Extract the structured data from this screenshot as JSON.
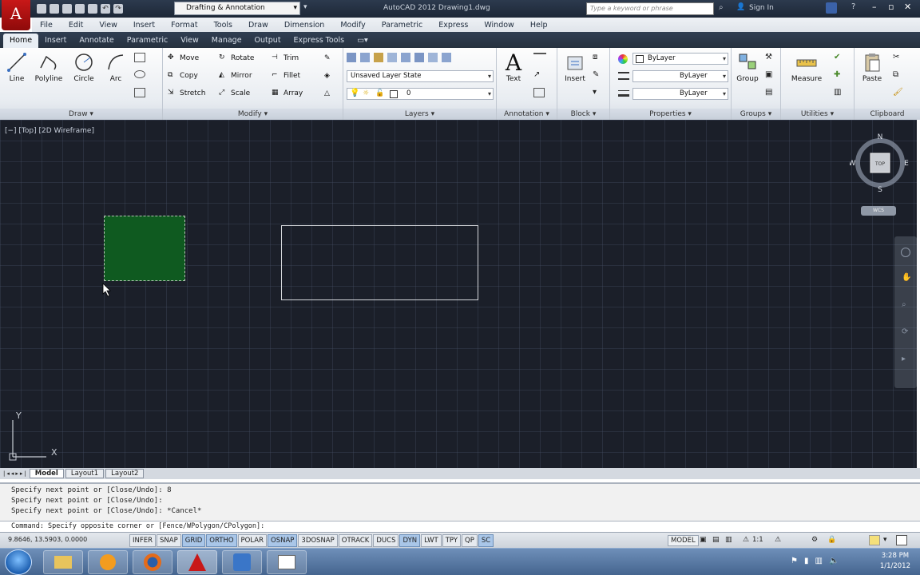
{
  "titlebar": {
    "workspace": "Drafting & Annotation",
    "title": "AutoCAD 2012   Drawing1.dwg",
    "search_placeholder": "Type a keyword or phrase",
    "signin": "Sign In"
  },
  "menubar": [
    "File",
    "Edit",
    "View",
    "Insert",
    "Format",
    "Tools",
    "Draw",
    "Dimension",
    "Modify",
    "Parametric",
    "Express",
    "Window",
    "Help"
  ],
  "tabs": [
    "Home",
    "Insert",
    "Annotate",
    "Parametric",
    "View",
    "Manage",
    "Output",
    "Express Tools"
  ],
  "ribbon": {
    "draw": {
      "title": "Draw",
      "line": "Line",
      "polyline": "Polyline",
      "circle": "Circle",
      "arc": "Arc"
    },
    "modify": {
      "title": "Modify",
      "move": "Move",
      "rotate": "Rotate",
      "trim": "Trim",
      "copy": "Copy",
      "mirror": "Mirror",
      "fillet": "Fillet",
      "stretch": "Stretch",
      "scale": "Scale",
      "array": "Array"
    },
    "layers": {
      "title": "Layers",
      "state": "Unsaved Layer State",
      "current": "0"
    },
    "annotation": {
      "title": "Annotation",
      "text": "Text"
    },
    "block": {
      "title": "Block",
      "insert": "Insert"
    },
    "properties": {
      "title": "Properties",
      "color": "ByLayer",
      "linetype": "ByLayer",
      "lineweight": "ByLayer"
    },
    "groups": {
      "title": "Groups",
      "group": "Group"
    },
    "utilities": {
      "title": "Utilities",
      "measure": "Measure"
    },
    "clipboard": {
      "title": "Clipboard",
      "paste": "Paste"
    }
  },
  "viewport": {
    "label": "[−] [Top] [2D Wireframe]",
    "compass": {
      "n": "N",
      "s": "S",
      "e": "E",
      "w": "W",
      "top": "TOP",
      "wcs": "WCS"
    },
    "ucs_y": "Y",
    "ucs_x": "X"
  },
  "layout_tabs": [
    "Model",
    "Layout1",
    "Layout2"
  ],
  "command": {
    "history": [
      "Specify next point or [Close/Undo]: 8",
      "Specify next point or [Close/Undo]:",
      "Specify next point or [Close/Undo]: *Cancel*"
    ],
    "prompt": "Command: Specify opposite corner or [Fence/WPolygon/CPolygon]:"
  },
  "status": {
    "coords": "9.8646, 13.5903, 0.0000",
    "toggles": [
      "INFER",
      "SNAP",
      "GRID",
      "ORTHO",
      "POLAR",
      "OSNAP",
      "3DOSNAP",
      "OTRACK",
      "DUCS",
      "DYN",
      "LWT",
      "TPY",
      "QP",
      "SC"
    ],
    "active": [
      "GRID",
      "ORTHO",
      "OSNAP",
      "DYN",
      "SC"
    ],
    "model": "MODEL",
    "scale": "1:1"
  },
  "taskbar": {
    "time": "3:28 PM",
    "date": "1/1/2012"
  },
  "colors": {
    "green_fill": "#0f5a20",
    "viewport_bg": "#1b1f29",
    "accent": "#c81818"
  }
}
